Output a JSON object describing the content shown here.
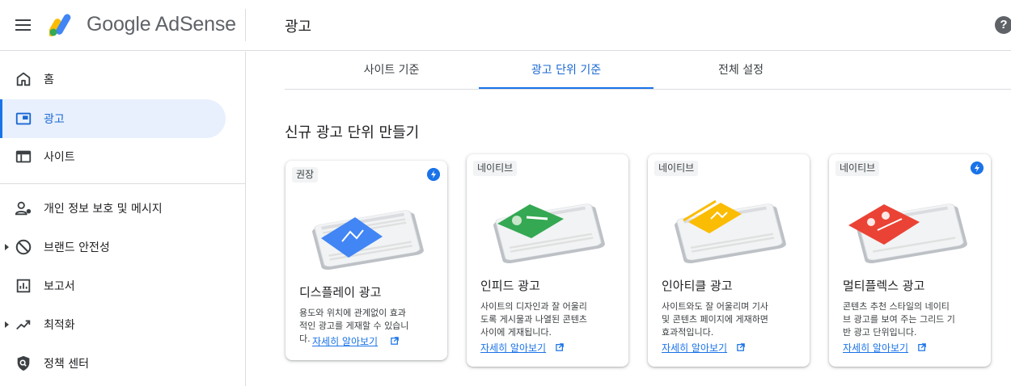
{
  "header": {
    "logo_text": "Google AdSense",
    "page_title": "광고",
    "help_icon_glyph": "?"
  },
  "sidebar": {
    "items": [
      {
        "label": "홈",
        "icon": "home-icon"
      },
      {
        "label": "광고",
        "icon": "ads-icon",
        "active": true
      },
      {
        "label": "사이트",
        "icon": "sites-icon"
      },
      {
        "label": "개인 정보 보호 및 메시지",
        "icon": "privacy-messaging-icon"
      },
      {
        "label": "브랜드 안전성",
        "icon": "block-icon",
        "expandable": true
      },
      {
        "label": "보고서",
        "icon": "reports-icon"
      },
      {
        "label": "최적화",
        "icon": "trending-up-icon",
        "expandable": true
      },
      {
        "label": "정책 센터",
        "icon": "policy-shield-icon"
      }
    ]
  },
  "tabs": [
    {
      "label": "사이트 기준"
    },
    {
      "label": "광고 단위 기준",
      "active": true
    },
    {
      "label": "전체 설정"
    }
  ],
  "section_title": "신규 광고 단위 만들기",
  "cards": [
    {
      "chip": "권장",
      "title": "디스플레이 광고",
      "lines": [
        "용도와 위치에 관계없이 효과",
        "적인 광고를 게재할 수 있습니",
        "다."
      ],
      "learn_more": "자세히 알아보기",
      "accent": "#4285f4",
      "has_bolt": true
    },
    {
      "chip": "네이티브",
      "title": "인피드 광고",
      "lines": [
        "사이트의 디자인과 잘 어울리",
        "도록 게시물과 나열된 콘텐츠",
        "사이에 게재됩니다."
      ],
      "learn_more": "자세히 알아보기",
      "accent": "#34a853",
      "has_bolt": false
    },
    {
      "chip": "네이티브",
      "title": "인아티클 광고",
      "lines": [
        "사이트와도 잘 어울리며 기사",
        "및 콘텐츠 페이지에 게재하면",
        "효과적입니다."
      ],
      "learn_more": "자세히 알아보기",
      "accent": "#fbbc04",
      "has_bolt": false
    },
    {
      "chip": "네이티브",
      "title": "멀티플렉스 광고",
      "lines": [
        "콘텐츠 추천 스타일의 네이티",
        "브 광고를 보여 주는 그리드 기",
        "반 광고 단위입니다."
      ],
      "learn_more": "자세히 알아보기",
      "accent": "#ea4335",
      "has_bolt": true
    }
  ],
  "colors": {
    "accent_blue": "#1a73e8",
    "active_nav_bg": "#e8f0fe",
    "logo_yellow": "#fbbc04",
    "logo_green": "#34a853",
    "logo_blue": "#4285f4"
  }
}
